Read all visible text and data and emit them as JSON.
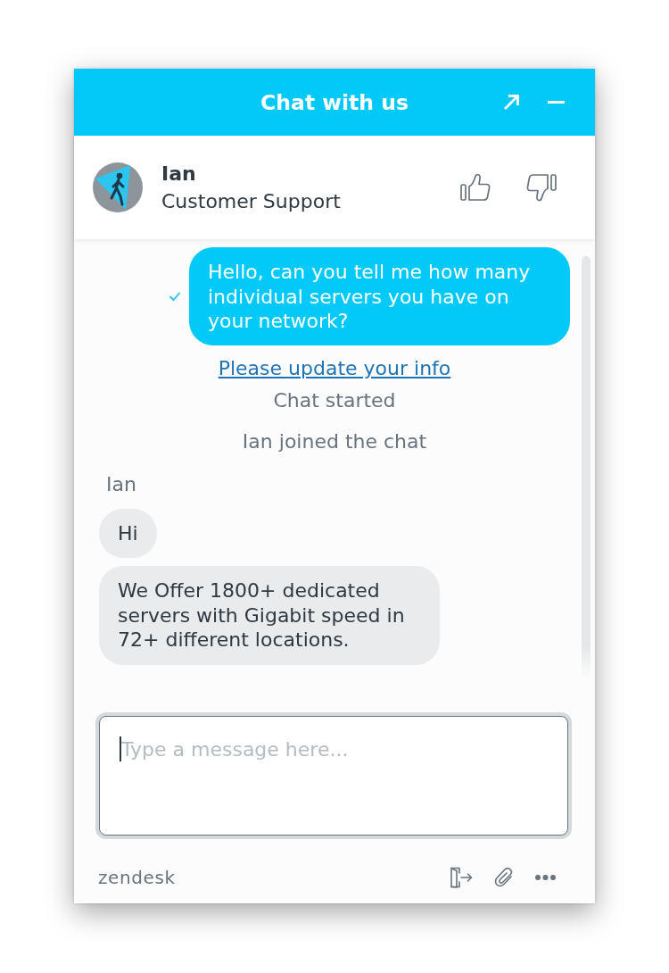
{
  "window": {
    "title": "Chat with us"
  },
  "agent": {
    "name": "Ian",
    "role": "Customer Support"
  },
  "messages": [
    {
      "kind": "visitor",
      "text": "Hello, can you tell me how many individual servers you have on your network?",
      "delivered": true
    },
    {
      "kind": "link",
      "text": "Please update your info"
    },
    {
      "kind": "event",
      "text": "Chat started"
    },
    {
      "kind": "event",
      "text": "Ian joined the chat"
    },
    {
      "kind": "sender",
      "text": "Ian"
    },
    {
      "kind": "agent",
      "text": "Hi"
    },
    {
      "kind": "agent",
      "text": "We Offer 1800+ dedicated servers with Gigabit speed in 72+ different locations."
    }
  ],
  "composer": {
    "placeholder": "Type a message here...",
    "focused": true
  },
  "footer": {
    "brand": "zendesk"
  }
}
